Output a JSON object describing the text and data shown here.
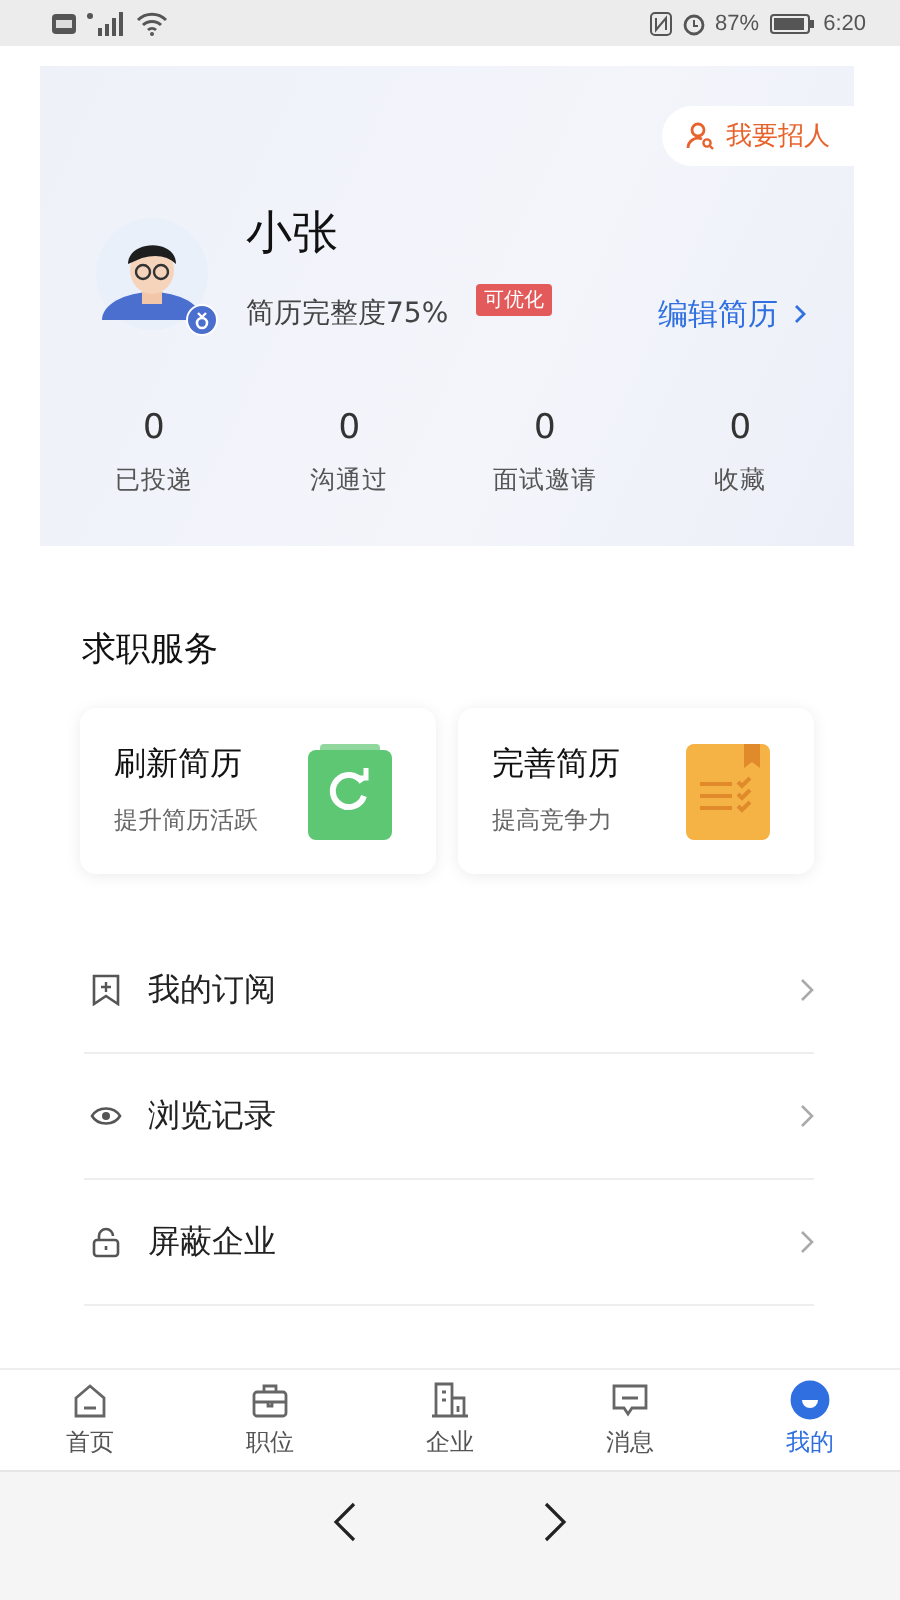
{
  "status_bar": {
    "battery": "87%",
    "time": "6:20"
  },
  "profile": {
    "recruit_button": "我要招人",
    "name": "小张",
    "completeness": "简历完整度75%",
    "badge": "可优化",
    "edit_link": "编辑简历",
    "stats": [
      {
        "value": "0",
        "label": "已投递"
      },
      {
        "value": "0",
        "label": "沟通过"
      },
      {
        "value": "0",
        "label": "面试邀请"
      },
      {
        "value": "0",
        "label": "收藏"
      }
    ]
  },
  "services": {
    "title": "求职服务",
    "cards": [
      {
        "title": "刷新简历",
        "subtitle": "提升简历活跃"
      },
      {
        "title": "完善简历",
        "subtitle": "提高竞争力"
      }
    ]
  },
  "menu": [
    {
      "label": "我的订阅"
    },
    {
      "label": "浏览记录"
    },
    {
      "label": "屏蔽企业"
    }
  ],
  "tabs": [
    {
      "label": "首页",
      "selected": false
    },
    {
      "label": "职位",
      "selected": false
    },
    {
      "label": "企业",
      "selected": false
    },
    {
      "label": "消息",
      "selected": false
    },
    {
      "label": "我的",
      "selected": true
    }
  ]
}
